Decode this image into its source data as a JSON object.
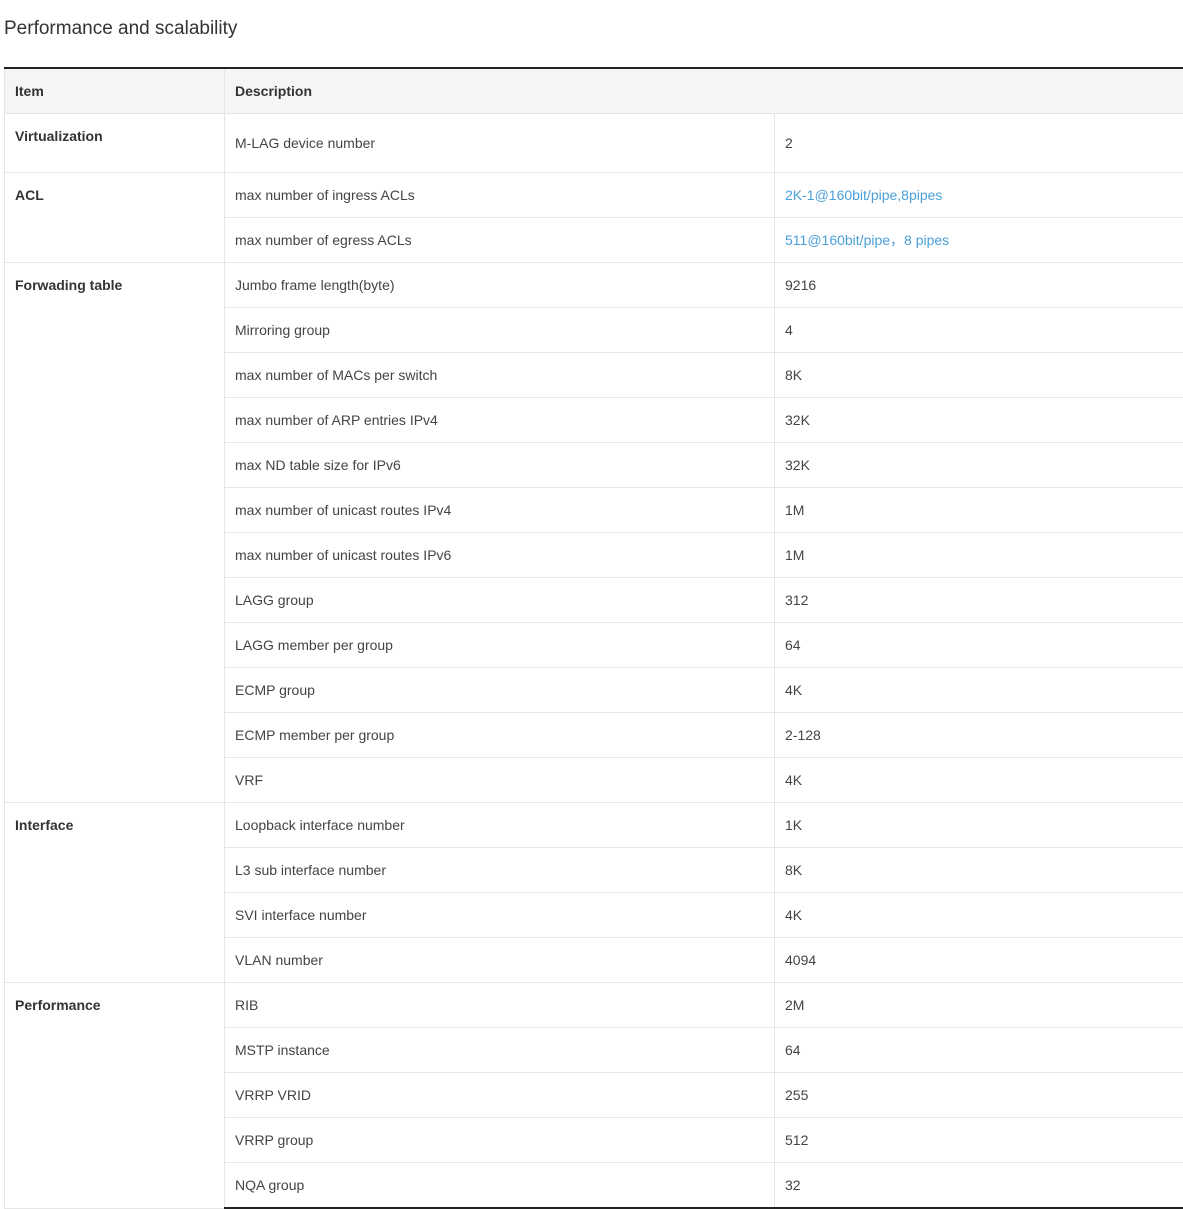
{
  "page": {
    "title": "Performance and scalability"
  },
  "table": {
    "headers": {
      "item": "Item",
      "description": "Description"
    },
    "groups": [
      {
        "item": "Virtualization",
        "rows": [
          {
            "description": "M-LAG device number",
            "value": "2"
          }
        ]
      },
      {
        "item": "ACL",
        "rows": [
          {
            "description": "max number of ingress ACLs",
            "value": "2K-1@160bit/pipe,8pipes",
            "is_link": true
          },
          {
            "description": "max number of egress ACLs",
            "value": "511@160bit/pipe，8 pipes",
            "is_link": true
          }
        ]
      },
      {
        "item": "Forwading table",
        "rows": [
          {
            "description": "Jumbo frame length(byte)",
            "value": "9216"
          },
          {
            "description": "Mirroring group",
            "value": "4"
          },
          {
            "description": "max number of MACs per switch",
            "value": "8K"
          },
          {
            "description": "max number of ARP entries IPv4",
            "value": "32K"
          },
          {
            "description": "max ND table size for IPv6",
            "value": "32K"
          },
          {
            "description": "max number of unicast routes IPv4",
            "value": "1M"
          },
          {
            "description": "max number of unicast routes IPv6",
            "value": "1M"
          },
          {
            "description": "LAGG group",
            "value": "312"
          },
          {
            "description": "LAGG member per group",
            "value": "64"
          },
          {
            "description": "ECMP group",
            "value": "4K"
          },
          {
            "description": "ECMP member per group",
            "value": "2-128"
          },
          {
            "description": "VRF",
            "value": "4K"
          }
        ]
      },
      {
        "item": "Interface",
        "rows": [
          {
            "description": "Loopback interface number",
            "value": "1K"
          },
          {
            "description": "L3 sub interface number",
            "value": "8K"
          },
          {
            "description": "SVI interface number",
            "value": "4K"
          },
          {
            "description": "VLAN number",
            "value": "4094"
          }
        ]
      },
      {
        "item": "Performance",
        "rows": [
          {
            "description": "RIB",
            "value": "2M"
          },
          {
            "description": "MSTP instance",
            "value": "64"
          },
          {
            "description": "VRRP VRID",
            "value": "255"
          },
          {
            "description": "VRRP group",
            "value": "512"
          },
          {
            "description": "NQA group",
            "value": "32"
          }
        ]
      }
    ]
  },
  "colors": {
    "link": "#4a9fd8",
    "text": "#444444",
    "header_bg": "#f5f5f5",
    "border": "#e6e6e6",
    "rule": "#222222"
  }
}
